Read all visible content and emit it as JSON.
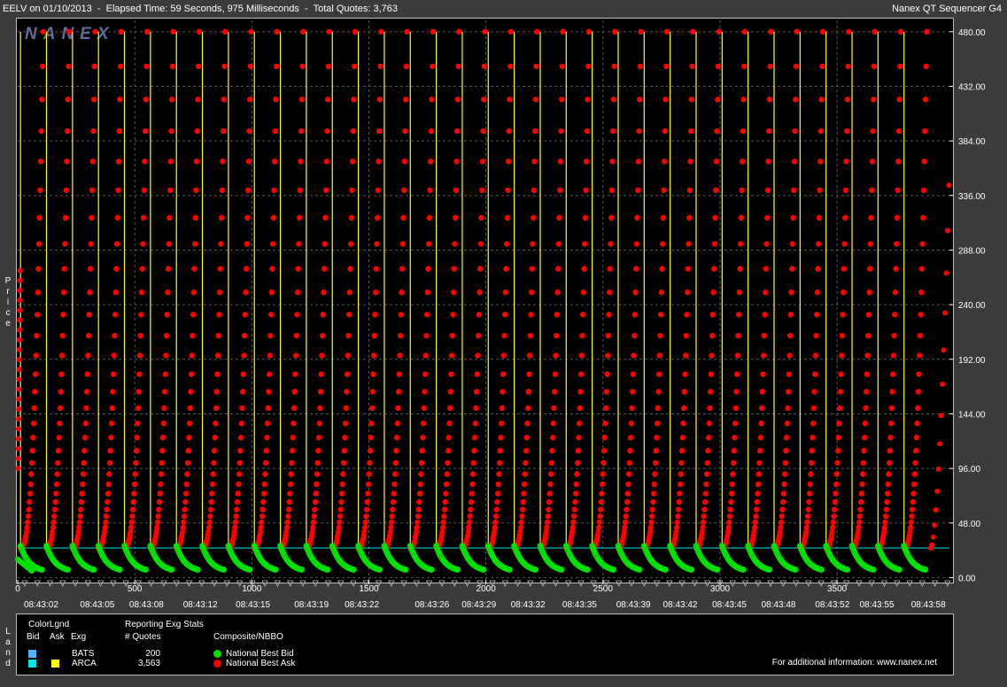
{
  "header": {
    "left_text": "EELV on 01/10/2013  -  Elapsed Time: 59 Seconds, 975 Milliseconds  -  Total Quotes: 3,763",
    "right_text": "Nanex QT Sequencer G4"
  },
  "watermark": "NANEX",
  "y_axis_label": "Price",
  "legend_side_label": "Land",
  "legend": {
    "colorlgnd_title": "ColorLgnd",
    "col_bid": "Bid",
    "col_ask": "Ask",
    "col_exg": "Exg",
    "reporting_title": "Reporting Exg Stats",
    "quotes_header": "# Quotes",
    "composite_title": "Composite/NBBO",
    "exchanges": [
      {
        "name": "BATS",
        "quotes": "200",
        "bid_color": "#4fb3ff",
        "ask_color": ""
      },
      {
        "name": "ARCA",
        "quotes": "3,563",
        "bid_color": "#00e5e5",
        "ask_color": "#ffff00"
      }
    ],
    "nbbo": [
      {
        "label": "National Best Bid",
        "color": "#00e000"
      },
      {
        "label": "National Best Ask",
        "color": "#ff0000"
      }
    ],
    "info": "For additional information: www.nanex.net"
  },
  "chart_data": {
    "type": "scatter",
    "x_label": "",
    "y_label": "Price",
    "x_ticks": [
      "0",
      "500",
      "1000",
      "1500",
      "2000",
      "2500",
      "3000",
      "3500"
    ],
    "x_tick_values": [
      0,
      500,
      1000,
      1500,
      2000,
      2500,
      3000,
      3500
    ],
    "xlim": [
      0,
      3980
    ],
    "time_labels": [
      "08:43:02",
      "08:43:05",
      "08:43:08",
      "08:43:12",
      "08:43:15",
      "08:43:19",
      "08:43:22",
      "08:43:26",
      "08:43:29",
      "08:43:32",
      "08:43:35",
      "08:43:39",
      "08:43:42",
      "08:43:45",
      "08:43:48",
      "08:43:52",
      "08:43:55",
      "08:43:58"
    ],
    "time_label_x": [
      100,
      340,
      550,
      780,
      1005,
      1255,
      1470,
      1770,
      1970,
      2180,
      2400,
      2630,
      2830,
      3040,
      3250,
      3480,
      3670,
      3890
    ],
    "y_ticks": [
      "480.00",
      "432.00",
      "384.00",
      "336.00",
      "288.00",
      "240.00",
      "192.00",
      "144.00",
      "96.00",
      "48.00",
      "0.00"
    ],
    "ylim": [
      -2,
      490
    ],
    "grid": true,
    "cycle_count": 35,
    "cycle_length_quotes": 111,
    "ask_cycle": {
      "start_price": 26,
      "end_price": 480
    },
    "bid_cycle": {
      "start_price": 28,
      "end_price": 5
    },
    "arca_bid_line_price": 26,
    "series": [
      {
        "name": "National Best Ask",
        "color": "#ff0000"
      },
      {
        "name": "National Best Bid",
        "color": "#00e000"
      }
    ]
  },
  "colors": {
    "background": "#3b3b3b",
    "plot_bg": "#000000",
    "grid": "#555555",
    "ask_line": "#ffff00",
    "bid_line": "#00e5e5",
    "ask_dot": "#ff0000",
    "bid_dot": "#00e000"
  }
}
